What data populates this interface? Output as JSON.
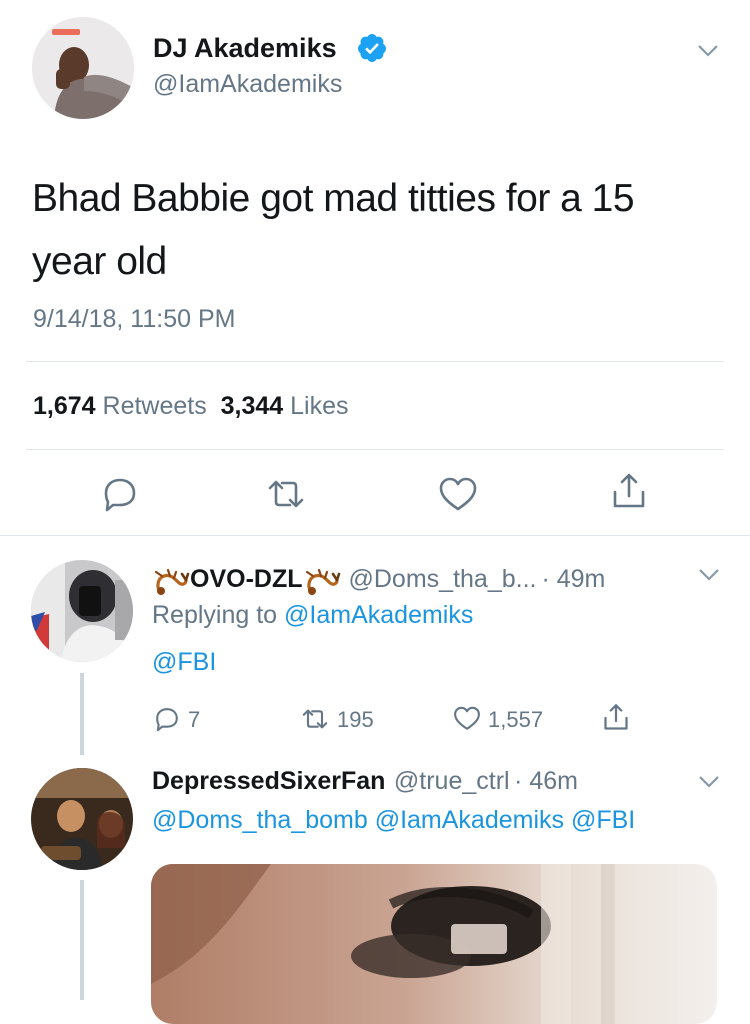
{
  "tweet": {
    "author_name": "DJ Akademiks",
    "handle": "@IamAkademiks",
    "text": "Bhad Babbie got mad titties for a 15 year old",
    "timestamp": "9/14/18, 11:50 PM",
    "retweet_count": "1,674",
    "retweet_label": "Retweets",
    "like_count": "3,344",
    "like_label": "Likes",
    "icons": [
      "reply-icon",
      "retweet-icon",
      "like-icon",
      "share-icon"
    ]
  },
  "replies": [
    {
      "name": "OVO-DZL",
      "emoji_icon": "scorpion-icon",
      "handle": "@Doms_tha_b...",
      "time": "· 49m",
      "replying_prefix": "Replying to",
      "replying_to": "@IamAkademiks",
      "text": "@FBI",
      "reply_count": "7",
      "retweet_count": "195",
      "like_count": "1,557"
    },
    {
      "name": "DepressedSixerFan",
      "handle": "@true_ctrl",
      "time": "· 46m",
      "text": "@Doms_tha_bomb @IamAkademiks @FBI"
    }
  ],
  "colors": {
    "link_blue": "#1b95e0",
    "verified_blue": "#1da1f2",
    "secondary_text": "#657786",
    "divider": "#e1e8ed"
  }
}
